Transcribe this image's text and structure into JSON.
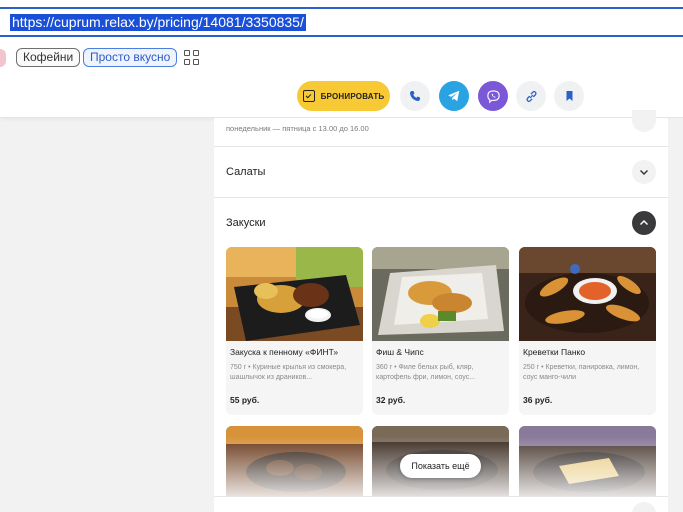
{
  "browser": {
    "url": "https://cuprum.relax.by/pricing/14081/3350835/"
  },
  "chips": {
    "items": [
      "Кофейни",
      "Просто вкусно"
    ]
  },
  "action_bar": {
    "book_label": "БРОНИРОВАТЬ",
    "accent_color": "#f7c934",
    "telegram_color": "#2aa3e2",
    "viber_color": "#7b58d8"
  },
  "content": {
    "hours_text": "понедельник — пятница с 13.00 до 16.00",
    "sections": {
      "salads": "Салаты",
      "snacks": "Закуски"
    },
    "cards": [
      {
        "title": "Закуска к пенному «ФИНТ»",
        "desc": "750 г • Куриные крылья из смокера, шашлычок из драников...",
        "price": "55 руб."
      },
      {
        "title": "Фиш & Чипс",
        "desc": "360 г • Филе белых рыб, кляр, картофель фри, лимон, соус...",
        "price": "32 руб."
      },
      {
        "title": "Креветки Панко",
        "desc": "250 г • Креветки, панировка, лимон, соус манго-чили",
        "price": "36 руб."
      }
    ],
    "show_more": "Показать ещё"
  }
}
